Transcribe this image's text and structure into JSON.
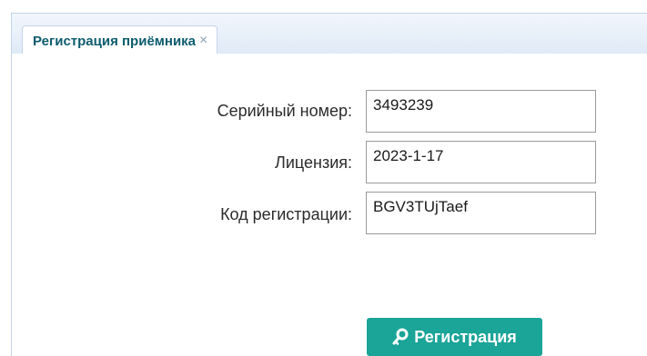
{
  "tab": {
    "label": "Регистрация приёмника",
    "close_glyph": "×"
  },
  "form": {
    "serial": {
      "label": "Серийный номер:",
      "value": "3493239"
    },
    "license": {
      "label": "Лицензия:",
      "value": "2023-1-17"
    },
    "regcode": {
      "label": "Код регистрации:",
      "value": "BGV3TUjTaef"
    }
  },
  "register_button": {
    "label": "Регистрация",
    "icon": "key-icon"
  },
  "colors": {
    "accent": "#1ba498",
    "tab_text": "#0c5c6e"
  }
}
